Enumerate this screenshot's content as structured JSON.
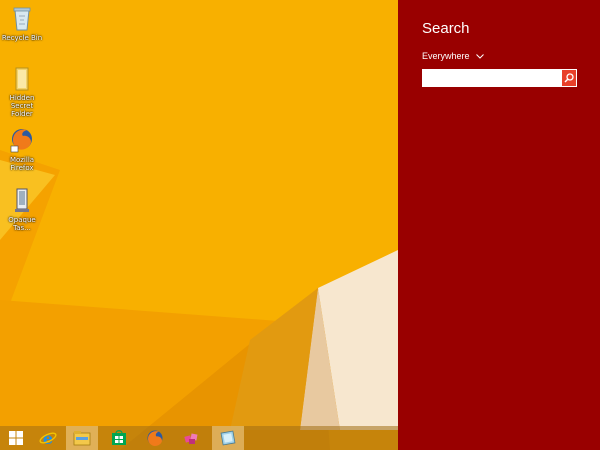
{
  "desktop": {
    "icons": [
      {
        "label": "Recycle Bin",
        "icon": "recycle-bin-icon"
      },
      {
        "label": "Hidden Secret Folder",
        "icon": "folder-icon"
      },
      {
        "label": "Mozilla Firefox",
        "icon": "firefox-icon"
      },
      {
        "label": "Opaque Tas...",
        "icon": "opaque-taskbar-icon"
      }
    ]
  },
  "taskbar": {
    "items": [
      {
        "icon": "windows-start-icon"
      },
      {
        "icon": "internet-explorer-icon"
      },
      {
        "icon": "file-explorer-icon"
      },
      {
        "icon": "store-icon"
      },
      {
        "icon": "firefox-icon"
      },
      {
        "icon": "app-icon"
      },
      {
        "icon": "opaque-taskbar-icon"
      }
    ]
  },
  "search_charm": {
    "title": "Search",
    "scope": "Everywhere",
    "input_value": "",
    "accent": "#990000"
  }
}
